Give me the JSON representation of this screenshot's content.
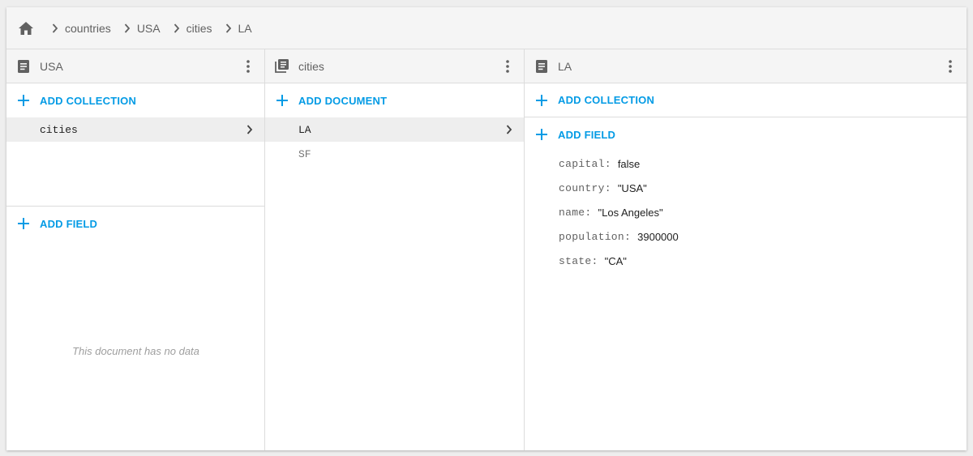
{
  "colors": {
    "accent": "#039be5",
    "header_bg": "#f5f5f5",
    "selected_bg": "#eeeeee",
    "border": "#dcdcdc"
  },
  "breadcrumb": {
    "home_icon": "home-icon",
    "items": [
      "countries",
      "USA",
      "cities",
      "LA"
    ]
  },
  "panel_document_usa": {
    "title": "USA",
    "icon": "document-icon",
    "add_collection_label": "ADD COLLECTION",
    "collections": [
      "cities"
    ],
    "add_field_label": "ADD FIELD",
    "empty_message": "This document has no data"
  },
  "panel_collection_cities": {
    "title": "cities",
    "icon": "collection-icon",
    "add_document_label": "ADD DOCUMENT",
    "documents": [
      "LA",
      "SF"
    ]
  },
  "panel_document_la": {
    "title": "LA",
    "icon": "document-icon",
    "add_collection_label": "ADD COLLECTION",
    "add_field_label": "ADD FIELD",
    "fields": [
      {
        "key": "capital:",
        "value": "false"
      },
      {
        "key": "country:",
        "value": "\"USA\""
      },
      {
        "key": "name:",
        "value": "\"Los Angeles\""
      },
      {
        "key": "population:",
        "value": "3900000"
      },
      {
        "key": "state:",
        "value": "\"CA\""
      }
    ]
  }
}
